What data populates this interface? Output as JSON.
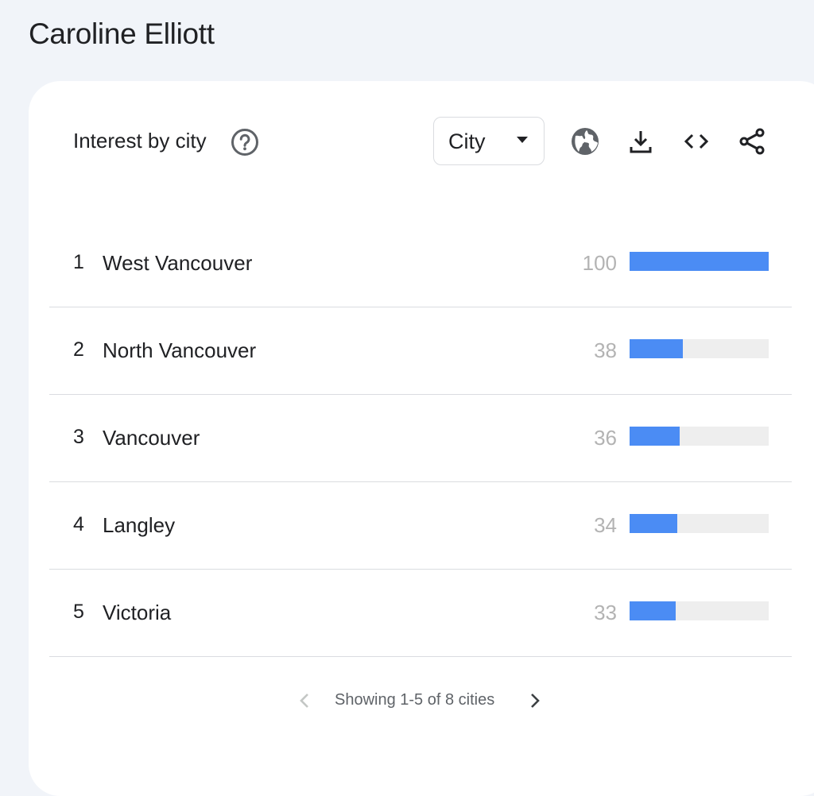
{
  "page": {
    "title": "Caroline Elliott"
  },
  "card": {
    "title": "Interest by city",
    "help_icon": "help-circle-icon",
    "resolution_dropdown": {
      "selected": "City"
    },
    "tools": [
      {
        "name": "globe-icon"
      },
      {
        "name": "download-icon"
      },
      {
        "name": "embed-code-icon"
      },
      {
        "name": "share-icon"
      }
    ],
    "rows": [
      {
        "rank": "1",
        "city": "West Vancouver",
        "value": "100",
        "level": 100
      },
      {
        "rank": "2",
        "city": "North Vancouver",
        "value": "38",
        "level": 38
      },
      {
        "rank": "3",
        "city": "Vancouver",
        "value": "36",
        "level": 36
      },
      {
        "rank": "4",
        "city": "Langley",
        "value": "34",
        "level": 34
      },
      {
        "rank": "5",
        "city": "Victoria",
        "value": "33",
        "level": 33
      }
    ],
    "pager": {
      "text": "Showing 1-5 of 8 cities"
    }
  },
  "colors": {
    "bar_fill": "#4b8cf4",
    "bar_track": "#eeeeee",
    "background": "#f1f4f9"
  }
}
